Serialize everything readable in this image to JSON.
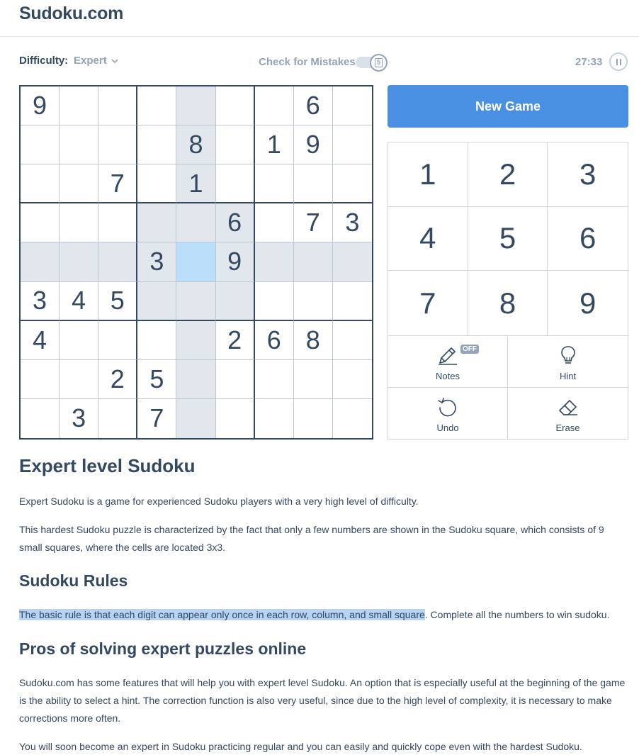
{
  "header": {
    "logo": "Sudoku.com"
  },
  "toolbar": {
    "difficulty_label": "Difficulty:",
    "difficulty_value": "Expert",
    "check_mistakes_label": "Check for Mistakes",
    "check_mistakes_enabled": false,
    "timer": "27:33"
  },
  "board": {
    "rows": [
      [
        "9",
        "",
        "",
        "",
        "",
        "",
        "",
        "6",
        ""
      ],
      [
        "",
        "",
        "",
        "",
        "8",
        "",
        "1",
        "9",
        ""
      ],
      [
        "",
        "",
        "7",
        "",
        "1",
        "",
        "",
        "",
        ""
      ],
      [
        "",
        "",
        "",
        "",
        "",
        "6",
        "",
        "7",
        "3"
      ],
      [
        "",
        "",
        "",
        "3",
        "",
        "9",
        "",
        "",
        ""
      ],
      [
        "3",
        "4",
        "5",
        "",
        "",
        "",
        "",
        "",
        ""
      ],
      [
        "4",
        "",
        "",
        "",
        "",
        "2",
        "6",
        "8",
        ""
      ],
      [
        "",
        "",
        "2",
        "5",
        "",
        "",
        "",
        "",
        ""
      ],
      [
        "",
        "3",
        "",
        "7",
        "",
        "",
        "",
        "",
        ""
      ]
    ],
    "selected_cell": "row 5, column 5",
    "colors": {
      "highlight": "#e2e7ed",
      "selected": "#bbdefb",
      "border": "#344861"
    }
  },
  "controls": {
    "new_game_label": "New Game",
    "numbers": [
      "1",
      "2",
      "3",
      "4",
      "5",
      "6",
      "7",
      "8",
      "9"
    ],
    "notes_label": "Notes",
    "notes_badge": "OFF",
    "hint_label": "Hint",
    "undo_label": "Undo",
    "erase_label": "Erase",
    "accent_color": "#4a90e2"
  },
  "article": {
    "title": "Expert level Sudoku",
    "intro_1": "Expert Sudoku is a game for experienced Sudoku players with a very high level of difficulty.",
    "intro_2": "This hardest Sudoku puzzle is characterized by the fact that only a few numbers are shown in the Sudoku square, which consists of 9 small squares, where the cells are located 3x3.",
    "rules_title": "Sudoku Rules",
    "rules_selected": "The basic rule is that each digit can appear only once in each row, column, and small square",
    "rules_rest": ". Complete all the numbers to win sudoku.",
    "pros_title": "Pros of solving expert puzzles online",
    "pros_1": "Sudoku.com has some features that will help you with expert level Sudoku. An option that is especially useful at the beginning of the game is the ability to select a hint. The correction function is also very useful, since due to the high level of complexity, it is necessary to make corrections more often.",
    "pros_2": "You will soon become an expert in Sudoku practicing regular and you can easily and quickly cope even with the hardest Sudoku."
  }
}
